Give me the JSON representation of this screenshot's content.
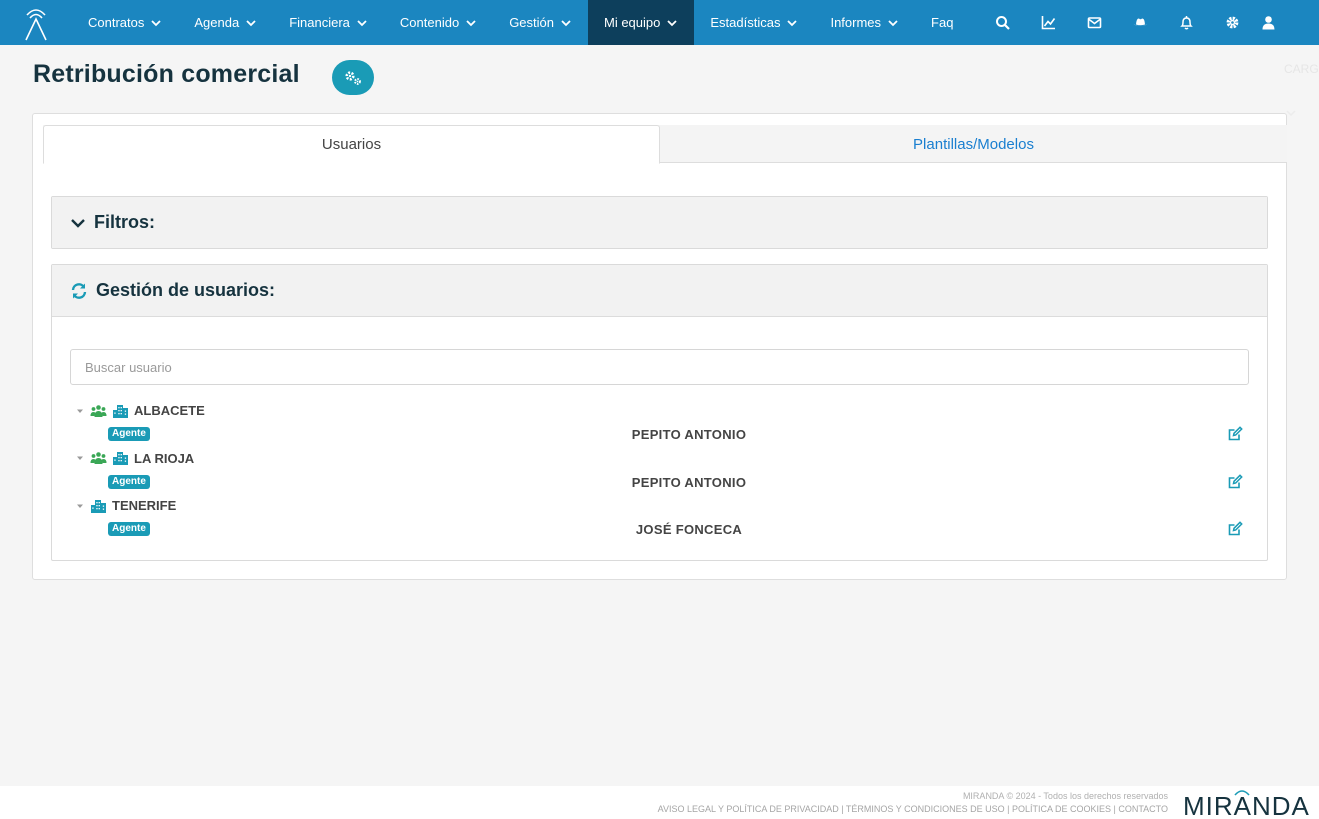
{
  "colors": {
    "nav_bg": "#1b86c0",
    "nav_active": "#0d3f5c",
    "accent": "#1a9bb6",
    "title": "#16333f",
    "link": "#1a7fd0",
    "green_icon": "#3aa756"
  },
  "nav": {
    "items": [
      {
        "label": "Contratos",
        "dropdown": true
      },
      {
        "label": "Agenda",
        "dropdown": true
      },
      {
        "label": "Financiera",
        "dropdown": true
      },
      {
        "label": "Contenido",
        "dropdown": true
      },
      {
        "label": "Gestión",
        "dropdown": true
      },
      {
        "label": "Mi equipo",
        "dropdown": true,
        "active": true
      },
      {
        "label": "Estadísticas",
        "dropdown": true
      },
      {
        "label": "Informes",
        "dropdown": true
      },
      {
        "label": "Faq",
        "dropdown": false
      }
    ],
    "icons": [
      "search-icon",
      "chart-line-icon",
      "envelope-icon",
      "hat-icon",
      "bell-icon",
      "cog-icon",
      "user-icon"
    ]
  },
  "page": {
    "title": "Retribución comercial",
    "ghost_text": "CARG"
  },
  "tabs": {
    "users": "Usuarios",
    "templates": "Plantillas/Modelos",
    "active": "users"
  },
  "filters": {
    "title": "Filtros:"
  },
  "users_panel": {
    "title": "Gestión de usuarios:",
    "search_placeholder": "Buscar usuario",
    "groups": [
      {
        "name": "ALBACETE",
        "team_icon": true,
        "role": "Agente",
        "user": "PEPITO ANTONIO"
      },
      {
        "name": "LA RIOJA",
        "team_icon": true,
        "role": "Agente",
        "user": "PEPITO ANTONIO"
      },
      {
        "name": "TENERIFE",
        "team_icon": false,
        "role": "Agente",
        "user": "JOSÉ FONCECA"
      }
    ]
  },
  "footer": {
    "copyright": "MIRANDA © 2024 - Todos los derechos reservados",
    "links": [
      "AVISO LEGAL Y POLÍTICA DE PRIVACIDAD",
      "TÉRMINOS Y CONDICIONES DE USO",
      "POLÍTICA DE COOKIES",
      "CONTACTO"
    ],
    "brand": "MIRANDA"
  }
}
